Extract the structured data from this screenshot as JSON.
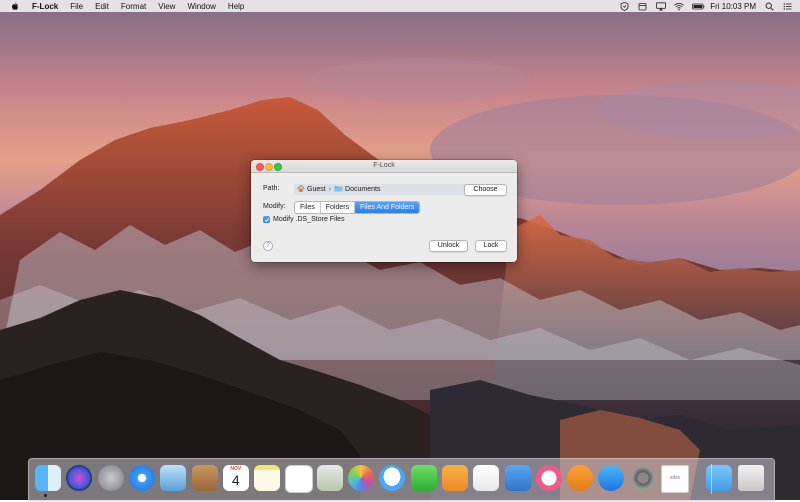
{
  "menubar": {
    "app_name": "F-Lock",
    "items": [
      "File",
      "Edit",
      "Format",
      "View",
      "Window",
      "Help"
    ],
    "clock": "Fri 10:03 PM"
  },
  "window": {
    "title": "F-Lock",
    "path_label": "Path:",
    "path_segments": [
      "Guest",
      "Documents"
    ],
    "choose_button": "Choose",
    "modify_label": "Modify:",
    "modify_options": [
      "Files",
      "Folders",
      "Files And Folders"
    ],
    "modify_selected": "Files And Folders",
    "checkbox_label": "Modify .DS_Store Files",
    "checkbox_checked": true,
    "help_button": "?",
    "unlock_button": "Unlock",
    "lock_button": "Lock"
  },
  "dock": {
    "apps": [
      {
        "name": "finder-icon"
      },
      {
        "name": "siri-icon"
      },
      {
        "name": "launchpad-icon"
      },
      {
        "name": "safari-icon"
      },
      {
        "name": "mail-icon"
      },
      {
        "name": "contacts-icon"
      },
      {
        "name": "calendar-icon",
        "month": "NOV",
        "day": "4"
      },
      {
        "name": "notes-icon"
      },
      {
        "name": "reminders-icon"
      },
      {
        "name": "preview-icon"
      },
      {
        "name": "photos-icon"
      },
      {
        "name": "messages-icon"
      },
      {
        "name": "facetime-icon"
      },
      {
        "name": "pages-icon"
      },
      {
        "name": "numbers-icon"
      },
      {
        "name": "keynote-icon"
      },
      {
        "name": "itunes-icon"
      },
      {
        "name": "ibooks-icon"
      },
      {
        "name": "app-store-icon"
      },
      {
        "name": "system-preferences-icon"
      },
      {
        "name": "document-icon",
        "text": "sdsx"
      },
      {
        "name": "downloads-folder-icon"
      },
      {
        "name": "trash-icon"
      }
    ]
  }
}
